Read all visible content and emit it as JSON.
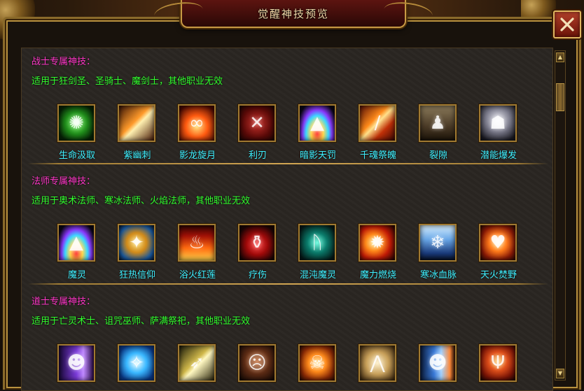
{
  "window": {
    "title": "觉醒神技预览"
  },
  "sections": [
    {
      "title": "战士专属神技：",
      "description": "适用于狂剑圣、圣骑士、魔剑士，其他职业无效",
      "skills": [
        {
          "name": "生命汲取",
          "icon": "green-orb-icon"
        },
        {
          "name": "紫幽刺",
          "icon": "slash-streak-icon"
        },
        {
          "name": "影龙旋月",
          "icon": "fire-swirl-icon"
        },
        {
          "name": "利刃",
          "icon": "blade-warrior-icon"
        },
        {
          "name": "暗影天罚",
          "icon": "prism-dome-icon"
        },
        {
          "name": "千魂祭魄",
          "icon": "flame-blade-icon"
        },
        {
          "name": "裂隙",
          "icon": "figures-shadow-icon"
        },
        {
          "name": "潜能爆发",
          "icon": "hooded-ghost-icon"
        }
      ]
    },
    {
      "title": "法师专属神技：",
      "description": "适用于奥术法师、寒冰法师、火焰法师，其他职业无效",
      "skills": [
        {
          "name": "魔灵",
          "icon": "prism-dome-icon"
        },
        {
          "name": "狂热信仰",
          "icon": "golden-shield-icon"
        },
        {
          "name": "浴火红莲",
          "icon": "flame-wall-icon"
        },
        {
          "name": "疗伤",
          "icon": "potion-bottle-icon"
        },
        {
          "name": "混沌魔灵",
          "icon": "chaos-claw-icon"
        },
        {
          "name": "魔力燃烧",
          "icon": "fire-burst-icon"
        },
        {
          "name": "寒冰血脉",
          "icon": "ice-spirit-icon"
        },
        {
          "name": "天火焚野",
          "icon": "fire-heart-icon"
        }
      ]
    },
    {
      "title": "道士专属神技：",
      "description": "适用于亡灵术士、诅咒巫师、萨满祭祀，其他职业无效",
      "skills": [
        {
          "name": "",
          "icon": "purple-clone-icon"
        },
        {
          "name": "",
          "icon": "blue-aura-icon"
        },
        {
          "name": "",
          "icon": "speed-runner-icon"
        },
        {
          "name": "",
          "icon": "screaming-face-icon"
        },
        {
          "name": "",
          "icon": "flame-skull-icon"
        },
        {
          "name": "",
          "icon": "praying-hands-icon"
        },
        {
          "name": "",
          "icon": "blue-clones-icon"
        },
        {
          "name": "",
          "icon": "fire-demon-icon"
        }
      ]
    }
  ],
  "colors": {
    "section_title": "#ff38c8",
    "section_desc": "#32ff2e",
    "skill_name": "#3ff0ff"
  }
}
